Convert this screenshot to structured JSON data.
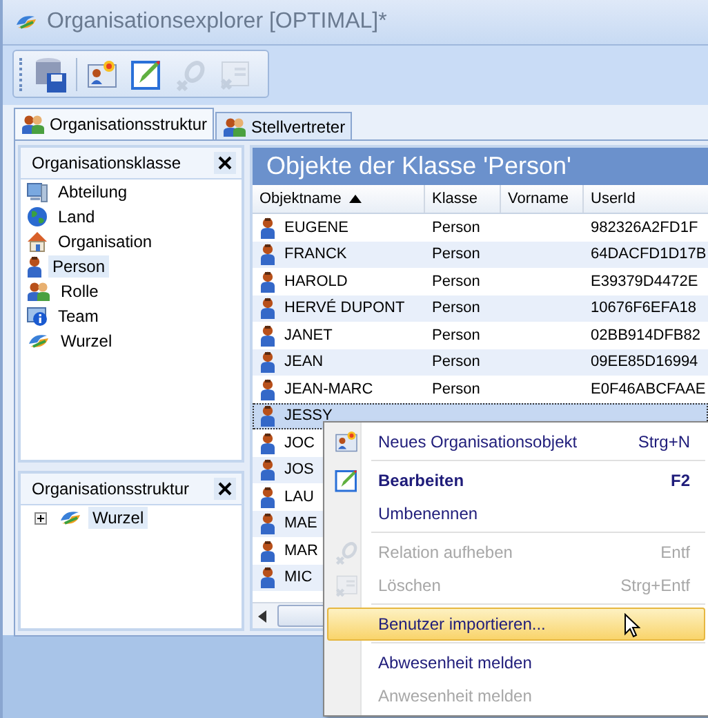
{
  "window": {
    "title": "Organisationsexplorer [OPTIMAL]*"
  },
  "toolbar": [
    {
      "kind": "save",
      "disabled": false
    },
    {
      "kind": "new",
      "disabled": false
    },
    {
      "kind": "edit",
      "disabled": false
    },
    {
      "kind": "unlink",
      "disabled": true
    },
    {
      "kind": "delete",
      "disabled": true
    }
  ],
  "tabs": [
    {
      "label": "Organisationsstruktur",
      "selected": true
    },
    {
      "label": "Stellvertreter",
      "selected": false
    }
  ],
  "class_panel": {
    "title": "Organisationsklasse",
    "items": [
      {
        "label": "Abteilung",
        "kind": "department",
        "selected": false
      },
      {
        "label": "Land",
        "kind": "country",
        "selected": false
      },
      {
        "label": "Organisation",
        "kind": "organisation",
        "selected": false
      },
      {
        "label": "Person",
        "kind": "person",
        "selected": true
      },
      {
        "label": "Rolle",
        "kind": "role",
        "selected": false
      },
      {
        "label": "Team",
        "kind": "team",
        "selected": false
      },
      {
        "label": "Wurzel",
        "kind": "root",
        "selected": false
      }
    ]
  },
  "tree_panel": {
    "title": "Organisationsstruktur",
    "items": [
      {
        "label": "Wurzel",
        "kind": "root",
        "expanded": false,
        "selected": true
      }
    ]
  },
  "grid": {
    "title": "Objekte der Klasse 'Person'",
    "columns": [
      {
        "label": "Objektname",
        "sorted": true
      },
      {
        "label": "Klasse",
        "sorted": false
      },
      {
        "label": "Vorname",
        "sorted": false
      },
      {
        "label": "UserId",
        "sorted": false
      }
    ],
    "rows": [
      {
        "name": "EUGENE",
        "klasse": "Person",
        "userid": "982326A2FD1F",
        "selected": false
      },
      {
        "name": "FRANCK",
        "klasse": "Person",
        "userid": "64DACFD1D17B",
        "selected": false
      },
      {
        "name": "HAROLD",
        "klasse": "Person",
        "userid": "E39379D4472E",
        "selected": false
      },
      {
        "name": "HERVÉ DUPONT",
        "klasse": "Person",
        "userid": "10676F6EFA18",
        "selected": false
      },
      {
        "name": "JANET",
        "klasse": "Person",
        "userid": "02BB914DFB82",
        "selected": false
      },
      {
        "name": "JEAN",
        "klasse": "Person",
        "userid": "09EE85D16994",
        "selected": false
      },
      {
        "name": "JEAN-MARC",
        "klasse": "Person",
        "userid": "E0F46ABCFAAE",
        "selected": false
      },
      {
        "name": "JESSY",
        "selected": true
      },
      {
        "name": "JOC",
        "selected": false
      },
      {
        "name": "JOS",
        "selected": false
      },
      {
        "name": "LAU",
        "selected": false
      },
      {
        "name": "MAE",
        "selected": false
      },
      {
        "name": "MAR",
        "selected": false
      },
      {
        "name": "MIC",
        "selected": false
      }
    ]
  },
  "context_menu": {
    "groups": [
      [
        {
          "label": "Neues Organisationsobjekt",
          "shortcut": "Strg+N",
          "kind": "new",
          "disabled": false,
          "default": false,
          "selected": false
        }
      ],
      [
        {
          "label": "Bearbeiten",
          "shortcut": "F2",
          "kind": "edit",
          "disabled": false,
          "default": true,
          "selected": false
        },
        {
          "label": "Umbenennen",
          "disabled": false,
          "default": false,
          "selected": false
        }
      ],
      [
        {
          "label": "Relation aufheben",
          "shortcut": "Entf",
          "kind": "unlink",
          "disabled": true,
          "default": false,
          "selected": false
        },
        {
          "label": "Löschen",
          "shortcut": "Strg+Entf",
          "kind": "delete",
          "disabled": true,
          "default": false,
          "selected": false
        }
      ],
      [
        {
          "label": "Benutzer importieren...",
          "disabled": false,
          "default": false,
          "selected": true
        }
      ],
      [
        {
          "label": "Abwesenheit melden",
          "disabled": false,
          "default": false,
          "selected": false
        },
        {
          "label": "Anwesenheit melden",
          "disabled": true,
          "default": false,
          "selected": false
        }
      ]
    ]
  }
}
